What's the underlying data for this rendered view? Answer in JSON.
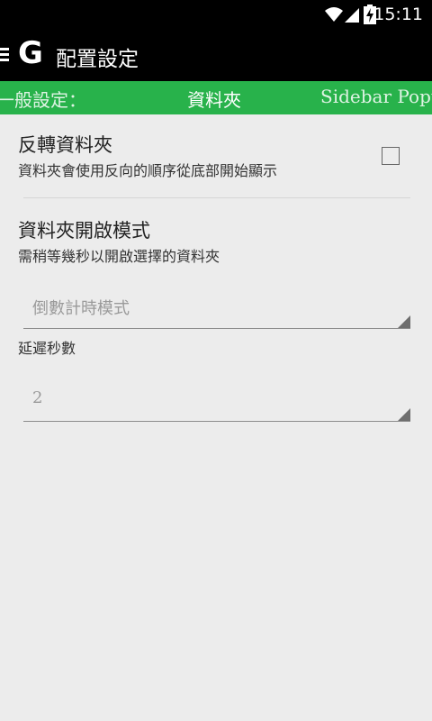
{
  "status_bar": {
    "time": "15:11"
  },
  "action_bar": {
    "logo": "G",
    "title": "配置設定"
  },
  "tabs": [
    {
      "label": "一般設定："
    },
    {
      "label": "資料夾"
    },
    {
      "label": "Sidebar Popup"
    }
  ],
  "prefs": {
    "reverse_folder": {
      "title": "反轉資料夾",
      "summary": "資料夾會使用反向的順序從底部開始顯示",
      "checked": false
    },
    "open_mode": {
      "title": "資料夾開啟模式",
      "summary": "需稍等幾秒以開啟選擇的資料夾",
      "selected": "倒數計時模式"
    },
    "delay": {
      "label": "延遲秒數",
      "value": "2"
    }
  },
  "colors": {
    "tab_bar": "#28b24b",
    "background": "#ececec",
    "action_bar": "#000000"
  }
}
